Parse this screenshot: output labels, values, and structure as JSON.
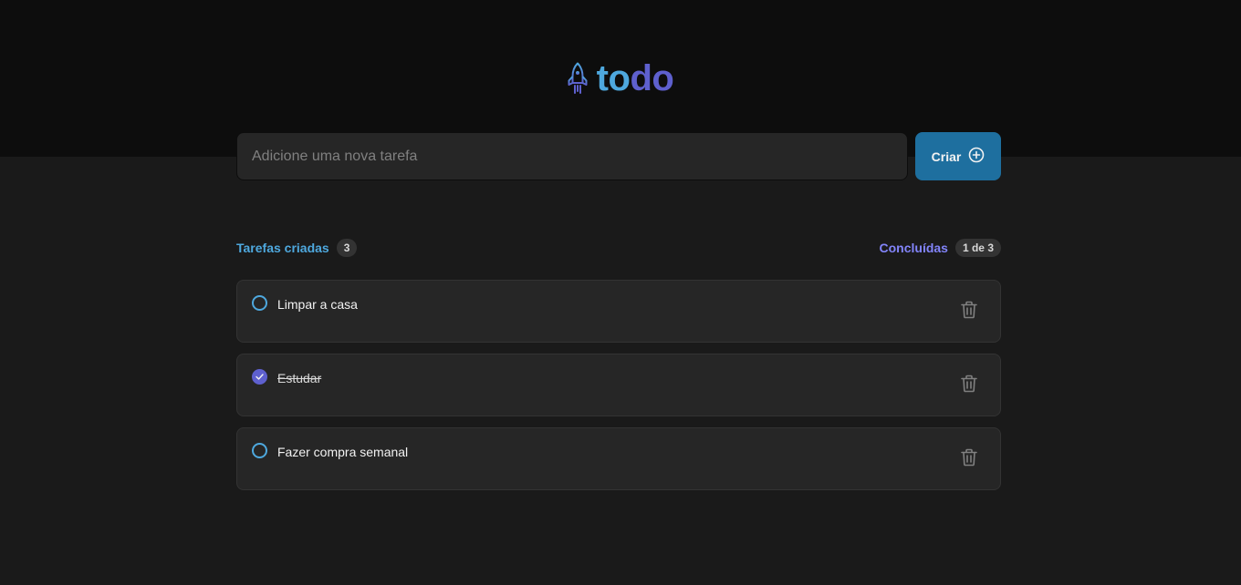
{
  "header": {
    "logo_part1": "to",
    "logo_part2": "do",
    "logo_icon": "rocket-icon"
  },
  "form": {
    "placeholder": "Adicione uma nova tarefa",
    "value": "",
    "create_label": "Criar",
    "create_icon": "plus-circle-icon"
  },
  "stats": {
    "created_label": "Tarefas criadas",
    "created_count": "3",
    "done_label": "Concluídas",
    "done_count": "1 de 3"
  },
  "tasks": [
    {
      "text": "Limpar a casa",
      "done": false
    },
    {
      "text": "Estudar",
      "done": true
    },
    {
      "text": "Fazer compra semanal",
      "done": false
    }
  ],
  "colors": {
    "blue": "#4ea8de",
    "purple": "#5e60ce",
    "purple_light": "#8284fa",
    "button": "#1e6f9f",
    "background": "#1a1a1a",
    "header_background": "#0d0d0d",
    "card": "#262626"
  }
}
